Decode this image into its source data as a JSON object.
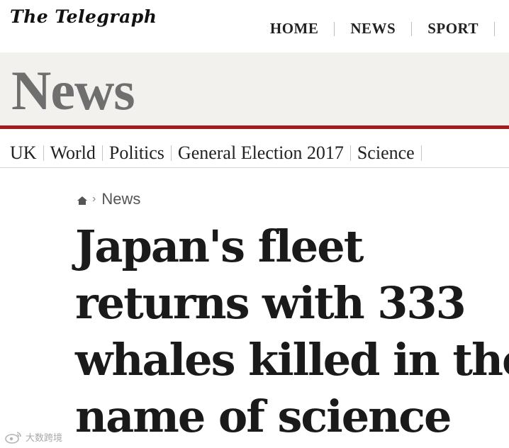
{
  "brand": {
    "logo_text": "The Telegraph"
  },
  "top_nav": {
    "items": [
      "HOME",
      "NEWS",
      "SPORT"
    ]
  },
  "section": {
    "title": "News"
  },
  "sub_nav": {
    "items": [
      "UK",
      "World",
      "Politics",
      "General Election 2017",
      "Science"
    ]
  },
  "breadcrumb": {
    "label": "News"
  },
  "article": {
    "headline_lines": [
      "Japan's fleet",
      "returns with 333",
      "whales killed in the",
      "name of science"
    ]
  },
  "watermark": {
    "text": "大数跨境"
  },
  "colors": {
    "accent_rule": "#a51a1f",
    "section_band": "#f3f1ed",
    "section_title": "#6f6f6f"
  },
  "icons": {
    "breadcrumb_home": "home-icon",
    "breadcrumb_chevron": "chevron-right-icon",
    "watermark": "weibo-icon"
  }
}
